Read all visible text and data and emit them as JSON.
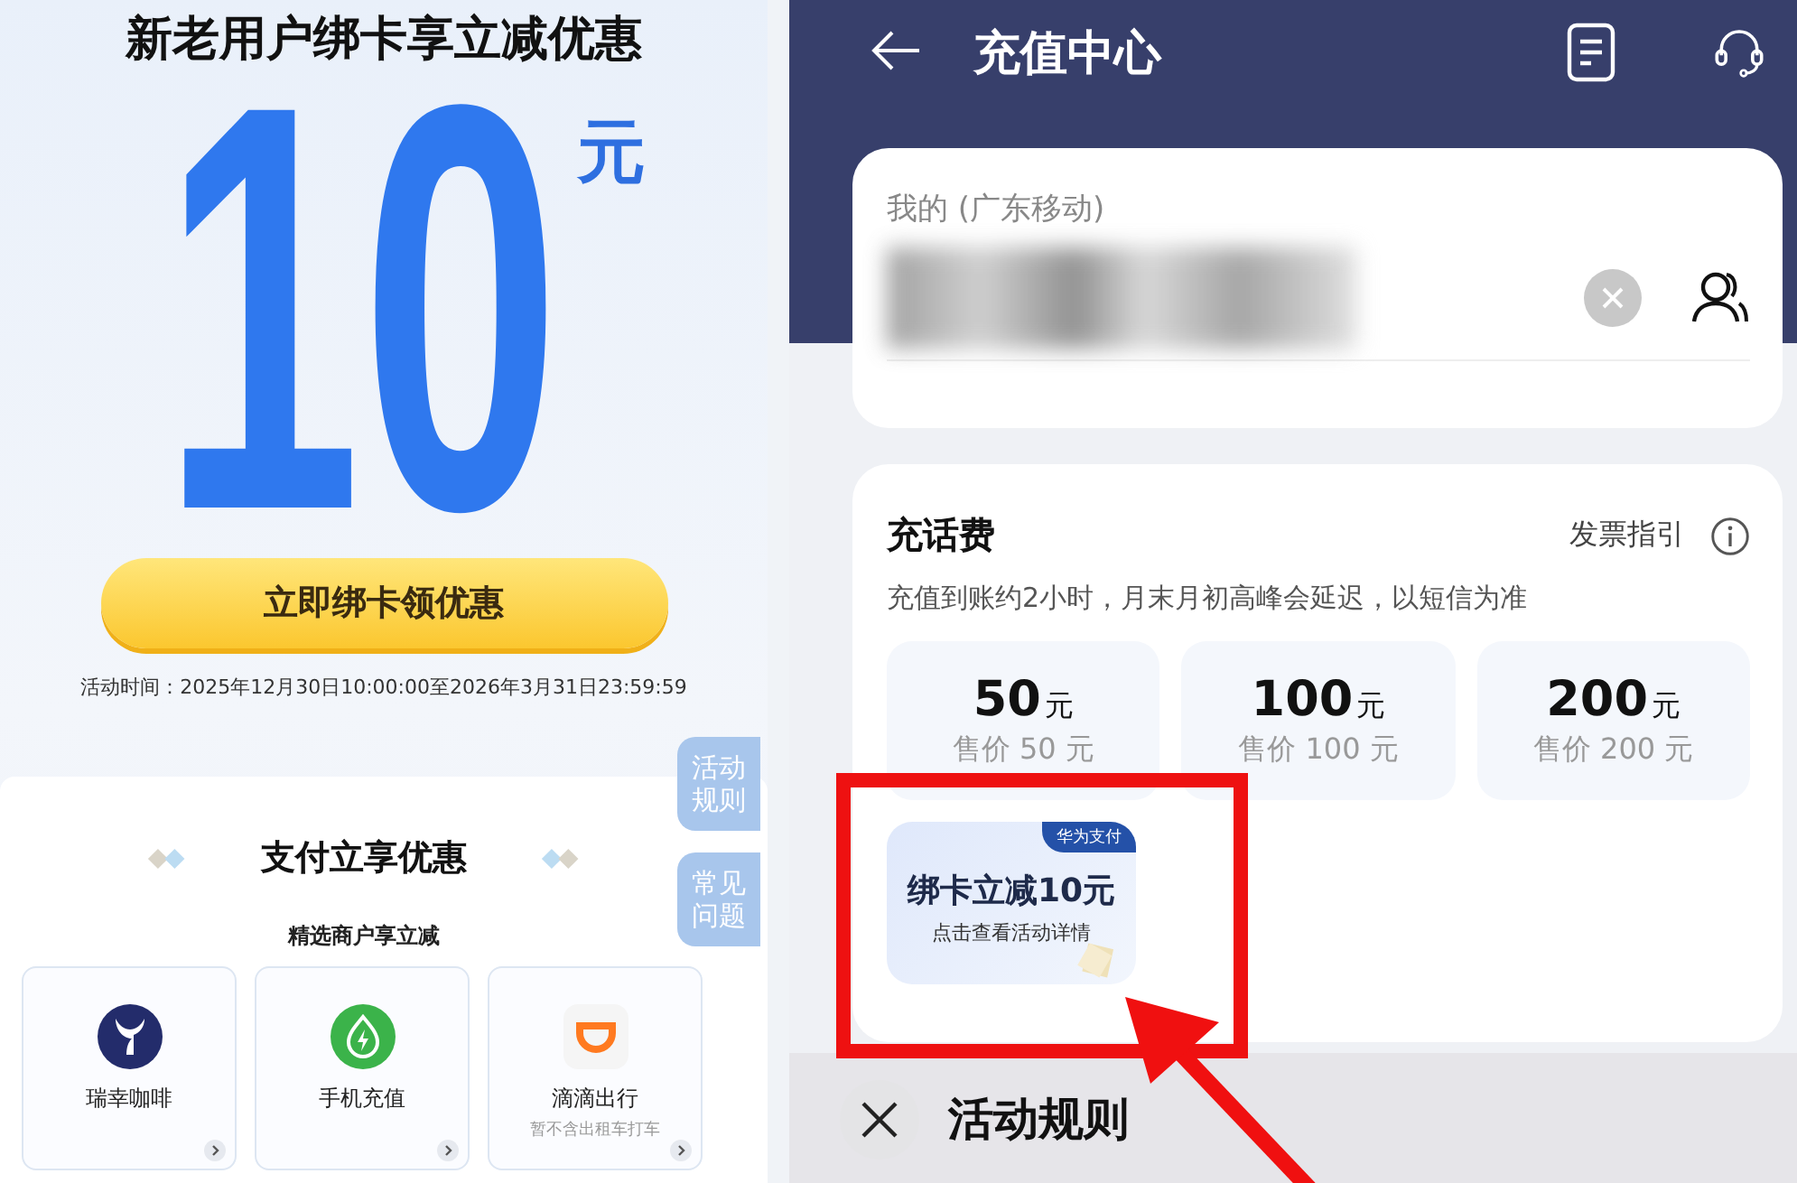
{
  "promo_page": {
    "title": "新老用户绑卡享立减优惠",
    "amount": "10",
    "unit": "元",
    "cta_button": "立即绑卡领优惠",
    "activity_time": "活动时间：2025年12月30日10:00:00至2026年3月31日23:59:59",
    "side_tabs": [
      "活动规则",
      "常见问题"
    ],
    "section_title": "支付立享优惠",
    "section_subtitle": "精选商户享立减",
    "merchants": [
      {
        "kind": "coffee",
        "name": "瑞幸咖啡"
      },
      {
        "kind": "recharge",
        "name": "手机充值"
      },
      {
        "kind": "ride",
        "name": "滴滴出行",
        "note": "暂不含出租车打车"
      }
    ]
  },
  "recharge_center": {
    "title": "充值中心",
    "account_label": "我的 (广东移动)",
    "section_title": "充话费",
    "invoice_link": "发票指引",
    "notice": "充值到账约2小时，月末月初高峰会延迟，以短信为准",
    "options": [
      {
        "amount": "50",
        "unit": "元",
        "price": "售价 50 元"
      },
      {
        "amount": "100",
        "unit": "元",
        "price": "售价 100 元"
      },
      {
        "amount": "200",
        "unit": "元",
        "price": "售价 200 元"
      }
    ],
    "promo_card": {
      "badge": "华为支付",
      "title": "绑卡立减10元",
      "subtitle": "点击查看活动详情"
    },
    "rules_sheet": {
      "title": "活动规则"
    }
  }
}
